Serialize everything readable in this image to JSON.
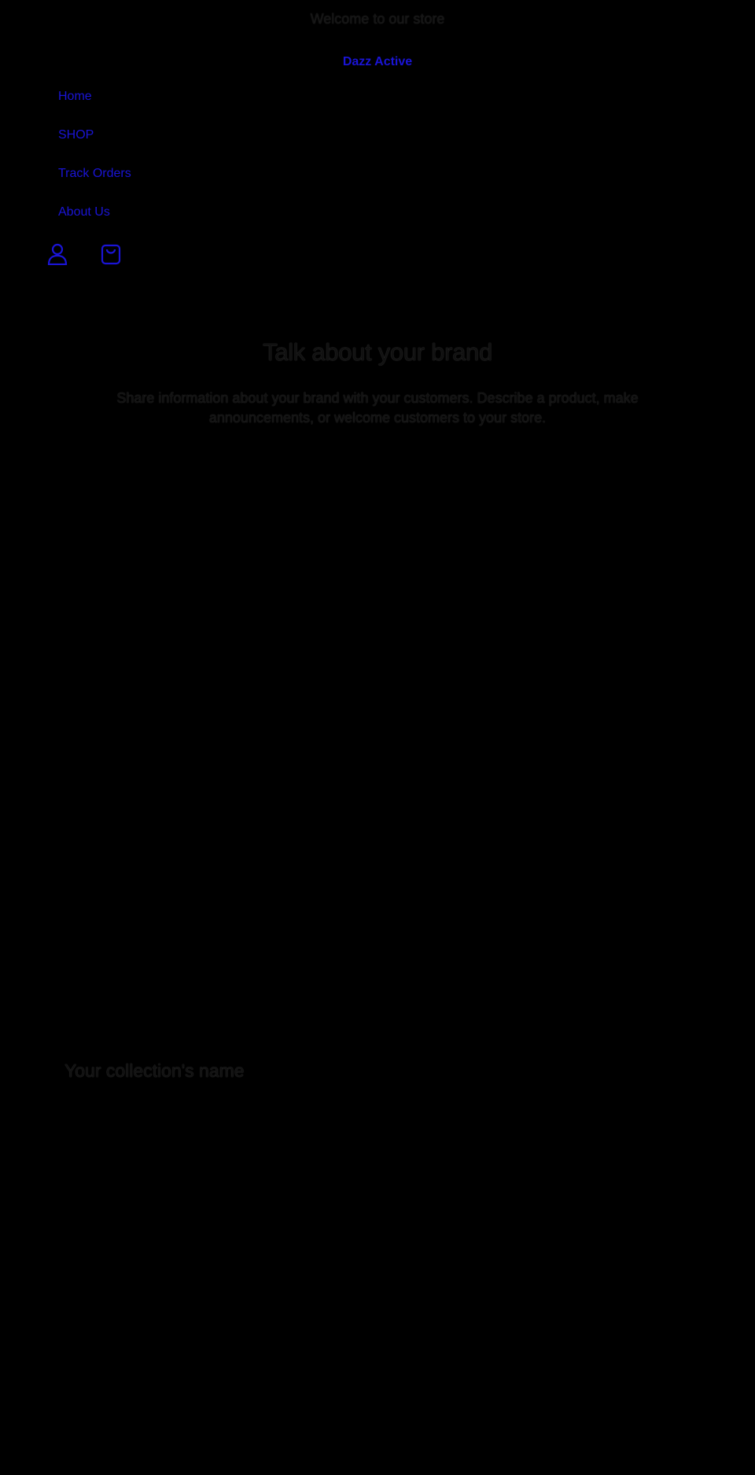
{
  "announcement": {
    "text": "Welcome to our store"
  },
  "header": {
    "brand": "Dazz Active",
    "nav": [
      {
        "label": "Home"
      },
      {
        "label": "SHOP"
      },
      {
        "label": "Track Orders"
      },
      {
        "label": "About Us"
      }
    ],
    "icons": {
      "account": "account-icon",
      "cart": "cart-icon"
    }
  },
  "rich_text": {
    "heading": "Talk about your brand",
    "body": "Share information about your brand with your customers. Describe a product, make announcements, or welcome customers to your store."
  },
  "collection": {
    "title": "Your collection's name"
  },
  "colors": {
    "background": "#000000",
    "link": "#1a14d6",
    "text": "#111111"
  }
}
